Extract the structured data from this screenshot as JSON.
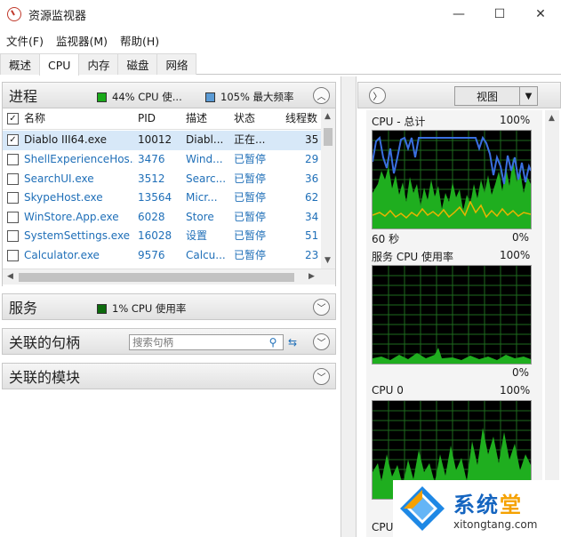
{
  "window": {
    "title": "资源监视器",
    "minimize": "—",
    "maximize": "☐",
    "close": "✕"
  },
  "menu": [
    "文件(F)",
    "监视器(M)",
    "帮助(H)"
  ],
  "tabs": [
    "概述",
    "CPU",
    "内存",
    "磁盘",
    "网络"
  ],
  "processes": {
    "title": "进程",
    "cpu_stat": "44% CPU 使...",
    "freq_stat": "105% 最大频率",
    "cpu_color": "#1aaa1a",
    "freq_color": "#5b9bd5",
    "columns": [
      "名称",
      "PID",
      "描述",
      "状态",
      "线程数"
    ],
    "rows": [
      {
        "name": "Diablo III64.exe",
        "pid": "10012",
        "desc": "Diabl...",
        "status": "正在...",
        "threads": "35",
        "checked": "✓"
      },
      {
        "name": "ShellExperienceHos...",
        "pid": "3476",
        "desc": "Wind...",
        "status": "已暂停",
        "threads": "29",
        "checked": ""
      },
      {
        "name": "SearchUI.exe",
        "pid": "3512",
        "desc": "Searc...",
        "status": "已暂停",
        "threads": "36",
        "checked": ""
      },
      {
        "name": "SkypeHost.exe",
        "pid": "13564",
        "desc": "Micr...",
        "status": "已暂停",
        "threads": "62",
        "checked": ""
      },
      {
        "name": "WinStore.App.exe",
        "pid": "6028",
        "desc": "Store",
        "status": "已暂停",
        "threads": "34",
        "checked": ""
      },
      {
        "name": "SystemSettings.exe",
        "pid": "16028",
        "desc": "设置",
        "status": "已暂停",
        "threads": "51",
        "checked": ""
      },
      {
        "name": "Calculator.exe",
        "pid": "9576",
        "desc": "Calcu...",
        "status": "已暂停",
        "threads": "23",
        "checked": ""
      }
    ]
  },
  "services": {
    "title": "服务",
    "cpu_stat": "1% CPU 使用率",
    "cpu_color": "#0d6b0d"
  },
  "handles": {
    "title": "关联的句柄",
    "search_placeholder": "搜索句柄"
  },
  "modules": {
    "title": "关联的模块"
  },
  "right": {
    "view_label": "视图",
    "graphs": [
      {
        "title": "CPU - 总计",
        "max": "100%",
        "time": "60 秒",
        "min": "0%"
      },
      {
        "title": "服务 CPU 使用率",
        "max": "100%",
        "min": "0%"
      },
      {
        "title": "CPU 0",
        "max": "100%"
      }
    ],
    "bottom_label": "CPU"
  },
  "watermark": {
    "title_a": "系统",
    "title_b": "堂",
    "url": "xitongtang.com"
  }
}
